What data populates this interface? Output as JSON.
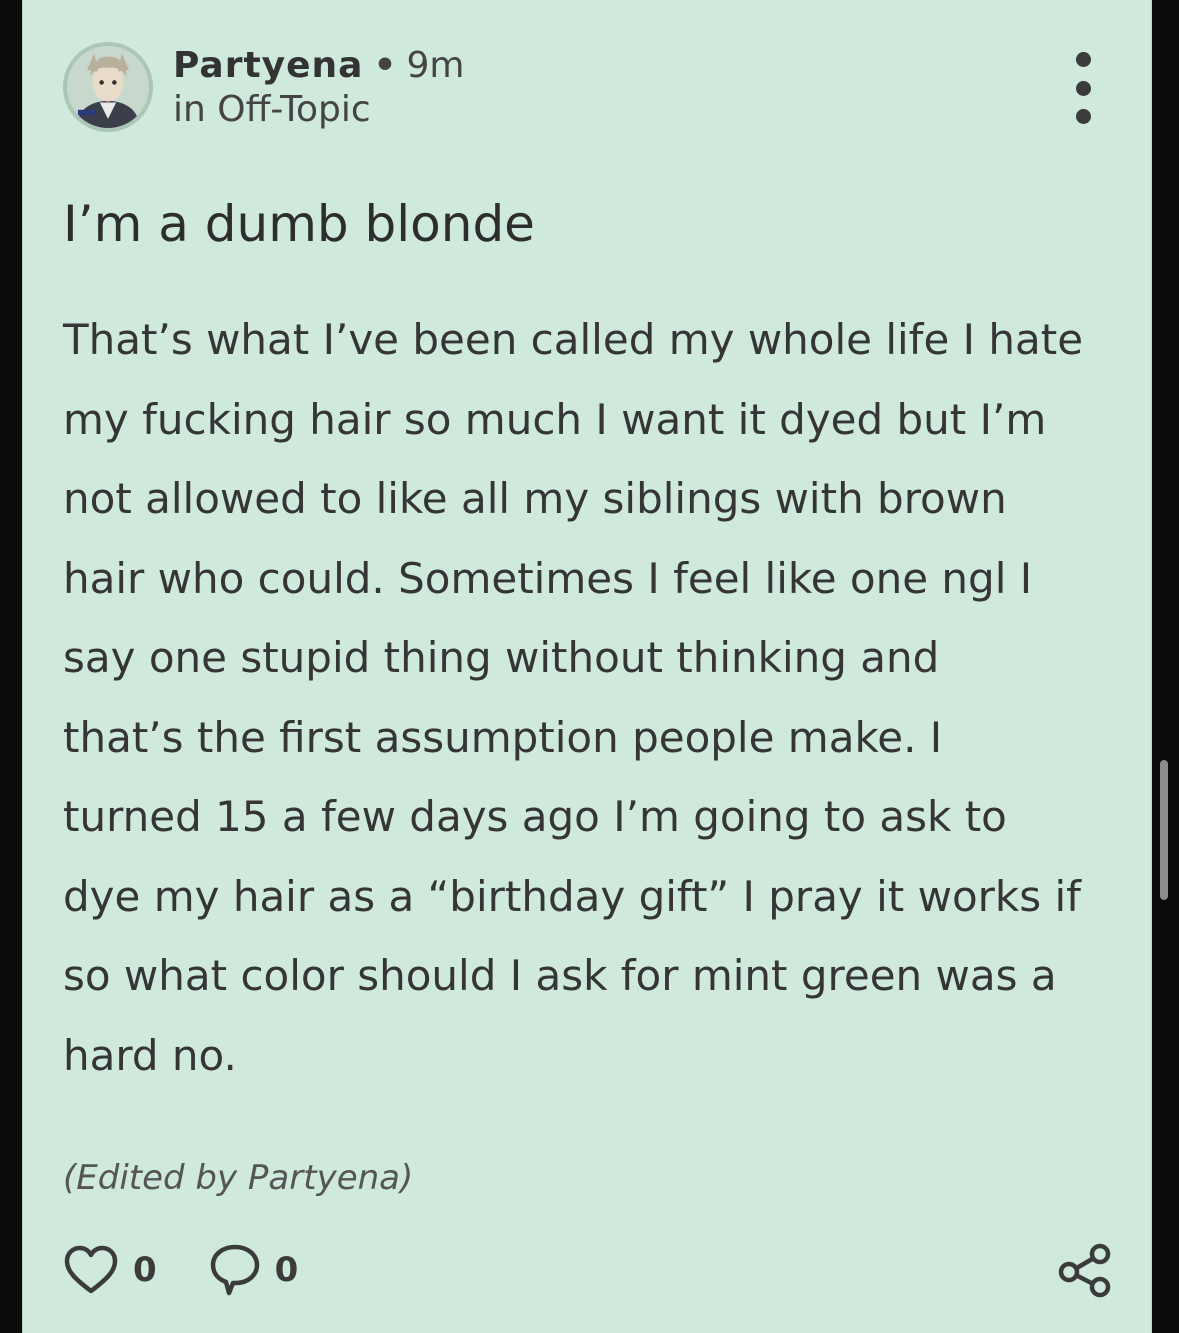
{
  "post": {
    "author": "Partyena",
    "separator": "•",
    "time": "9m",
    "community": "in Off-Topic",
    "title": "I’m a dumb blonde",
    "body_lines": [
      "That’s what I’ve been called my whole life I hate",
      "my fucking hair so much I want it dyed but I’m",
      "not allowed to like all my siblings with brown",
      "hair who could. Sometimes I feel like one ngl I",
      "say one stupid thing without thinking and",
      "that’s the first assumption people make. I",
      "turned 15 a few days ago I’m going to ask to",
      "dye my hair as a “birthday gift” I pray it works if",
      "so what color should I ask for mint green was a",
      "hard no."
    ],
    "edited_note": "(Edited by Partyena)",
    "likes": "0",
    "comments": "0"
  },
  "icons": {
    "avatar": "avatar-image",
    "more": "more-vertical-icon",
    "like": "heart-icon",
    "comment": "comment-bubble-icon",
    "share": "share-icon"
  },
  "colors": {
    "card_background": "#cfeadd",
    "page_background": "#0b0b0b",
    "text": "#353535"
  }
}
